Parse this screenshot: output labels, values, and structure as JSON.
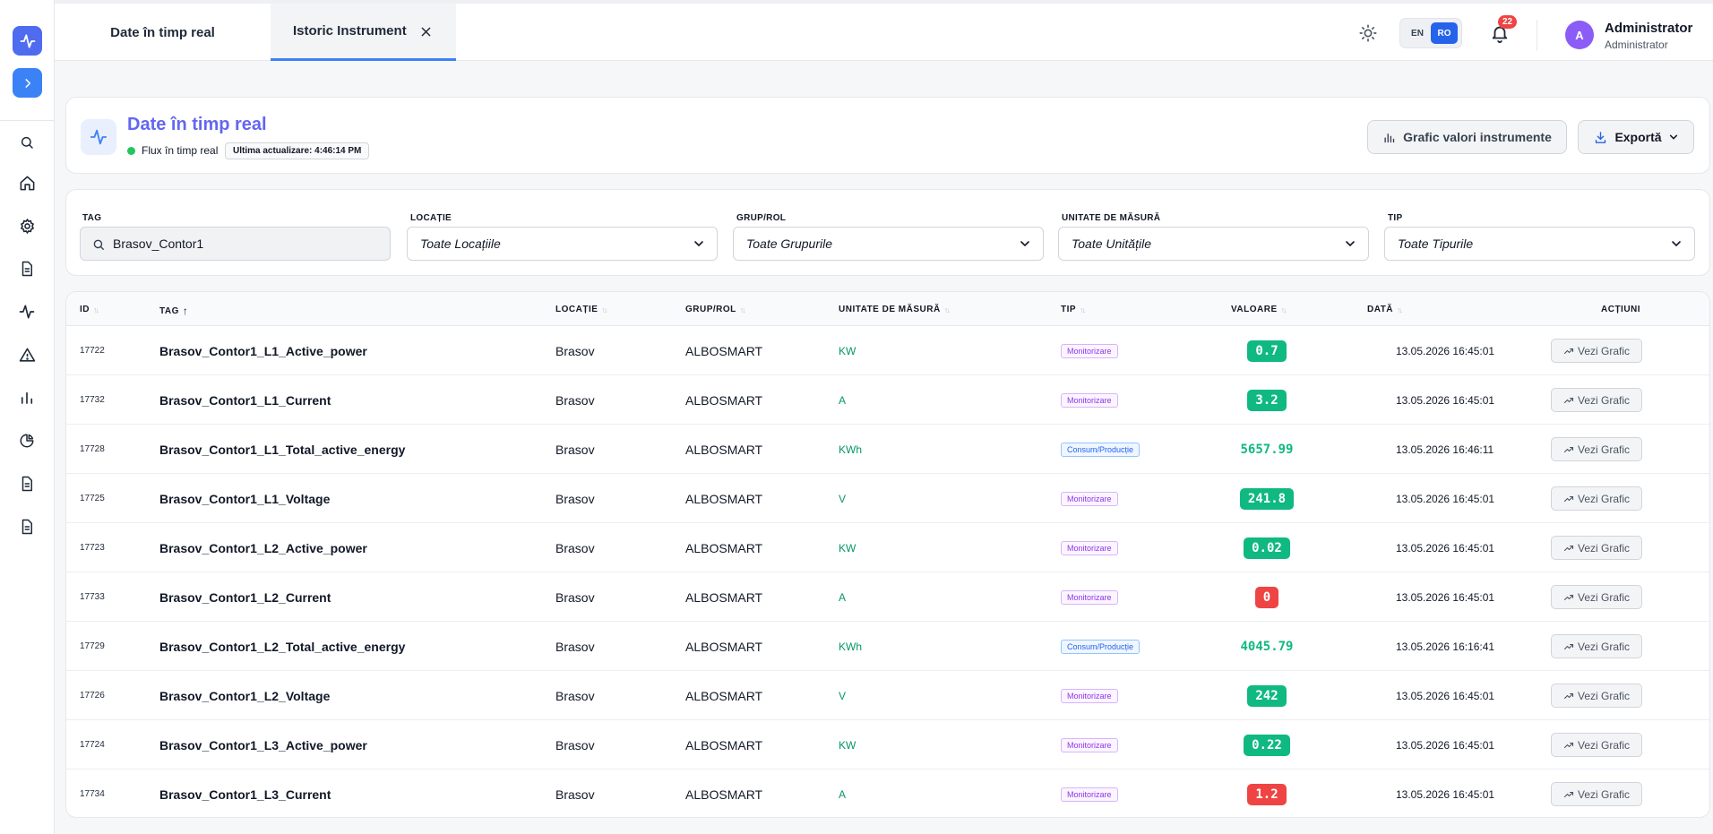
{
  "tabs": [
    {
      "label": "Date în timp real"
    },
    {
      "label": "Istoric Instrument"
    }
  ],
  "topbar": {
    "lang_en": "EN",
    "lang_ro": "RO",
    "notifications": "22",
    "avatar_initial": "A",
    "user_name": "Administrator",
    "user_role": "Administrator"
  },
  "header": {
    "title": "Date în timp real",
    "live_text": "Flux în timp real",
    "last_update": "Ultima actualizare: 4:46:14 PM",
    "chart_button": "Grafic valori instrumente",
    "export_button": "Exportă"
  },
  "filters": {
    "tag_label": "TAG",
    "tag_value": "Brasov_Contor1",
    "location_label": "LOCAȚIE",
    "location_value": "Toate Locațiile",
    "group_label": "GRUP/ROL",
    "group_value": "Toate Grupurile",
    "unit_label": "UNITATE DE MĂSURĂ",
    "unit_value": "Toate Unitățile",
    "type_label": "TIP",
    "type_value": "Toate Tipurile"
  },
  "table": {
    "headers": {
      "id": "ID",
      "tag": "TAG",
      "location": "LOCAȚIE",
      "group": "GRUP/ROL",
      "unit": "UNITATE DE MĂSURĂ",
      "type": "TIP",
      "value": "VALOARE",
      "date": "DATĂ",
      "actions": "ACȚIUNI"
    },
    "action_label": "Vezi Grafic",
    "rows": [
      {
        "id": "17722",
        "tag": "Brasov_Contor1_L1_Active_power",
        "location": "Brasov",
        "group": "ALBOSMART",
        "unit": "KW",
        "type": "Monitorizare",
        "type_kind": "mon",
        "value": "0.7",
        "value_kind": "green",
        "date": "13.05.2026 16:45:01"
      },
      {
        "id": "17732",
        "tag": "Brasov_Contor1_L1_Current",
        "location": "Brasov",
        "group": "ALBOSMART",
        "unit": "A",
        "type": "Monitorizare",
        "type_kind": "mon",
        "value": "3.2",
        "value_kind": "green",
        "date": "13.05.2026 16:45:01"
      },
      {
        "id": "17728",
        "tag": "Brasov_Contor1_L1_Total_active_energy",
        "location": "Brasov",
        "group": "ALBOSMART",
        "unit": "KWh",
        "type": "Consum/Producție",
        "type_kind": "cons",
        "value": "5657.99",
        "value_kind": "plain",
        "date": "13.05.2026 16:46:11"
      },
      {
        "id": "17725",
        "tag": "Brasov_Contor1_L1_Voltage",
        "location": "Brasov",
        "group": "ALBOSMART",
        "unit": "V",
        "type": "Monitorizare",
        "type_kind": "mon",
        "value": "241.8",
        "value_kind": "green",
        "date": "13.05.2026 16:45:01"
      },
      {
        "id": "17723",
        "tag": "Brasov_Contor1_L2_Active_power",
        "location": "Brasov",
        "group": "ALBOSMART",
        "unit": "KW",
        "type": "Monitorizare",
        "type_kind": "mon",
        "value": "0.02",
        "value_kind": "green",
        "date": "13.05.2026 16:45:01"
      },
      {
        "id": "17733",
        "tag": "Brasov_Contor1_L2_Current",
        "location": "Brasov",
        "group": "ALBOSMART",
        "unit": "A",
        "type": "Monitorizare",
        "type_kind": "mon",
        "value": "0",
        "value_kind": "red",
        "date": "13.05.2026 16:45:01"
      },
      {
        "id": "17729",
        "tag": "Brasov_Contor1_L2_Total_active_energy",
        "location": "Brasov",
        "group": "ALBOSMART",
        "unit": "KWh",
        "type": "Consum/Producție",
        "type_kind": "cons",
        "value": "4045.79",
        "value_kind": "plain",
        "date": "13.05.2026 16:16:41"
      },
      {
        "id": "17726",
        "tag": "Brasov_Contor1_L2_Voltage",
        "location": "Brasov",
        "group": "ALBOSMART",
        "unit": "V",
        "type": "Monitorizare",
        "type_kind": "mon",
        "value": "242",
        "value_kind": "green",
        "date": "13.05.2026 16:45:01"
      },
      {
        "id": "17724",
        "tag": "Brasov_Contor1_L3_Active_power",
        "location": "Brasov",
        "group": "ALBOSMART",
        "unit": "KW",
        "type": "Monitorizare",
        "type_kind": "mon",
        "value": "0.22",
        "value_kind": "green",
        "date": "13.05.2026 16:45:01"
      },
      {
        "id": "17734",
        "tag": "Brasov_Contor1_L3_Current",
        "location": "Brasov",
        "group": "ALBOSMART",
        "unit": "A",
        "type": "Monitorizare",
        "type_kind": "mon",
        "value": "1.2",
        "value_kind": "red",
        "date": "13.05.2026 16:45:01"
      }
    ]
  },
  "colors": {
    "accent": "#3b82f6",
    "title": "#6366f1",
    "value_green": "#10b981",
    "value_red": "#ef4444"
  }
}
